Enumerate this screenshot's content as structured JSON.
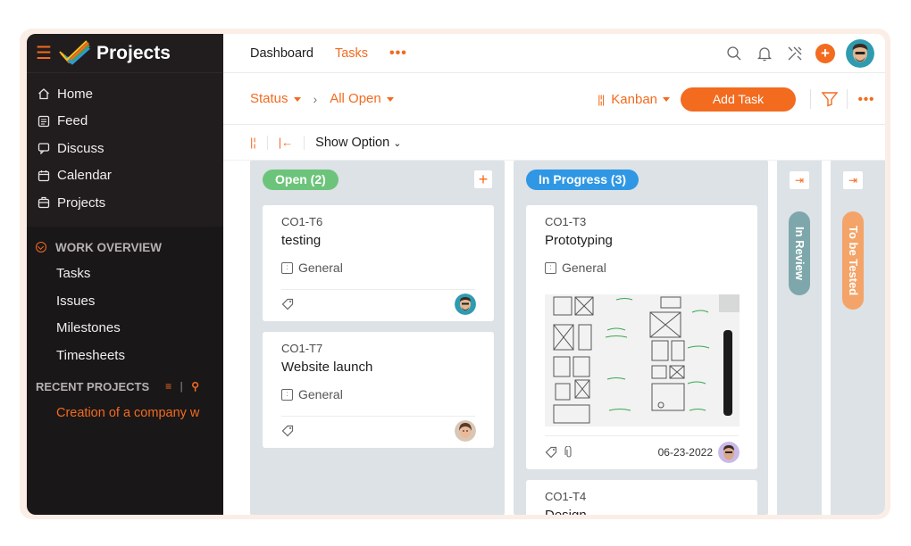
{
  "app": {
    "title": "Projects"
  },
  "sidebar": {
    "nav": [
      {
        "label": "Home",
        "icon": "home-icon"
      },
      {
        "label": "Feed",
        "icon": "feed-icon"
      },
      {
        "label": "Discuss",
        "icon": "discuss-icon"
      },
      {
        "label": "Calendar",
        "icon": "calendar-icon"
      },
      {
        "label": "Projects",
        "icon": "projects-icon"
      }
    ],
    "work_overview": {
      "heading": "WORK OVERVIEW",
      "items": [
        "Tasks",
        "Issues",
        "Milestones",
        "Timesheets"
      ]
    },
    "recent": {
      "heading": "RECENT PROJECTS",
      "project": "Creation of a company w"
    }
  },
  "topbar": {
    "links": [
      "Dashboard",
      "Tasks"
    ],
    "more": "•••",
    "add": "+"
  },
  "filterbar": {
    "status": "Status",
    "filter": "All Open",
    "view": "Kanban",
    "add_task": "Add Task",
    "more": "•••"
  },
  "optbar": {
    "show_option": "Show Option"
  },
  "columns": {
    "open": {
      "label": "Open (2)",
      "color": "#6cc47a"
    },
    "in_progress": {
      "label": "In Progress (3)",
      "color": "#2f97e4"
    },
    "in_review": {
      "label": "In Review",
      "color": "#7ea7ab"
    },
    "to_be_tested": {
      "label": "To be Tested",
      "color": "#f4a468"
    }
  },
  "cards": {
    "t6": {
      "id": "CO1-T6",
      "name": "testing",
      "category": "General"
    },
    "t7": {
      "id": "CO1-T7",
      "name": "Website launch",
      "category": "General"
    },
    "t3": {
      "id": "CO1-T3",
      "name": "Prototyping",
      "category": "General",
      "date": "06-23-2022"
    },
    "t4": {
      "id": "CO1-T4",
      "name": "Design"
    }
  },
  "colors": {
    "accent": "#f26b1f",
    "sidebar": "#1a1718"
  }
}
